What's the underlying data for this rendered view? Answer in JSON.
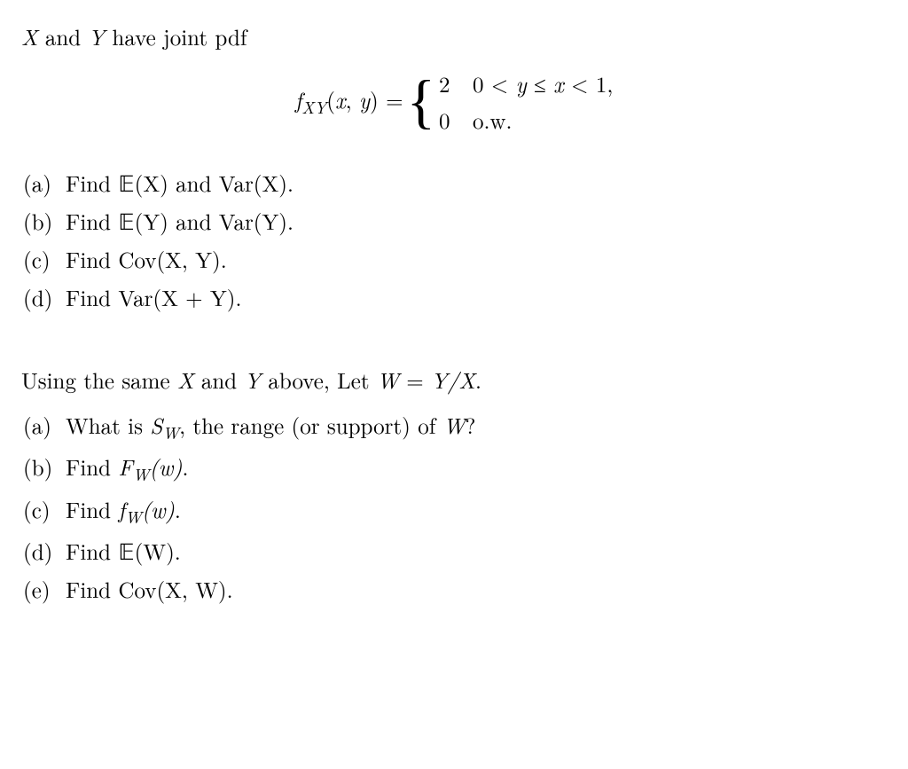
{
  "intro": {
    "prefix": " and ",
    "X": "X",
    "Y": "Y",
    "suffix": " have joint pdf"
  },
  "equation": {
    "func_f": "f",
    "sub": "XY",
    "args_open": "(",
    "arg_x": "x",
    "arg_sep": ", ",
    "arg_y": "y",
    "args_close": ")",
    "eq": " = ",
    "case1_val": "2",
    "case1_cond_a": "0 < ",
    "case1_cond_y": "y",
    "case1_cond_b": " ≤ ",
    "case1_cond_x": "x",
    "case1_cond_c": " < 1,",
    "case2_val": "0",
    "case2_cond": "o.w."
  },
  "list1": [
    {
      "label": "(a)",
      "prefix": "Find ",
      "expr1": "𝔼(X)",
      "mid": " and ",
      "expr2": "Var(X)",
      "suffix": "."
    },
    {
      "label": "(b)",
      "prefix": "Find ",
      "expr1": "𝔼(Y)",
      "mid": " and ",
      "expr2": "Var(Y)",
      "suffix": "."
    },
    {
      "label": "(c)",
      "prefix": "Find ",
      "expr1": "Cov(X, Y)",
      "mid": "",
      "expr2": "",
      "suffix": "."
    },
    {
      "label": "(d)",
      "prefix": "Find ",
      "expr1": "Var(X + Y)",
      "mid": "",
      "expr2": "",
      "suffix": "."
    }
  ],
  "intro2": {
    "a": "Using the same ",
    "X": "X",
    "b": " and ",
    "Y": "Y",
    "c": " above, Let ",
    "W": "W",
    "eq": " = ",
    "ratio": "Y/X",
    "dot": "."
  },
  "list2": [
    {
      "label": "(a)",
      "text_a": "What is ",
      "expr": "S",
      "sub": "W",
      "text_b": ", the range (or support) of ",
      "W": "W",
      "text_c": "?"
    },
    {
      "label": "(b)",
      "text_a": "Find ",
      "expr": "F",
      "sub": "W",
      "arg": "(w)",
      "text_c": "."
    },
    {
      "label": "(c)",
      "text_a": "Find ",
      "expr": "f",
      "sub": "W",
      "arg": "(w)",
      "text_c": "."
    },
    {
      "label": "(d)",
      "text_a": "Find ",
      "expr": "𝔼(W)",
      "text_c": "."
    },
    {
      "label": "(e)",
      "text_a": "Find ",
      "expr": "Cov(X, W)",
      "text_c": "."
    }
  ]
}
